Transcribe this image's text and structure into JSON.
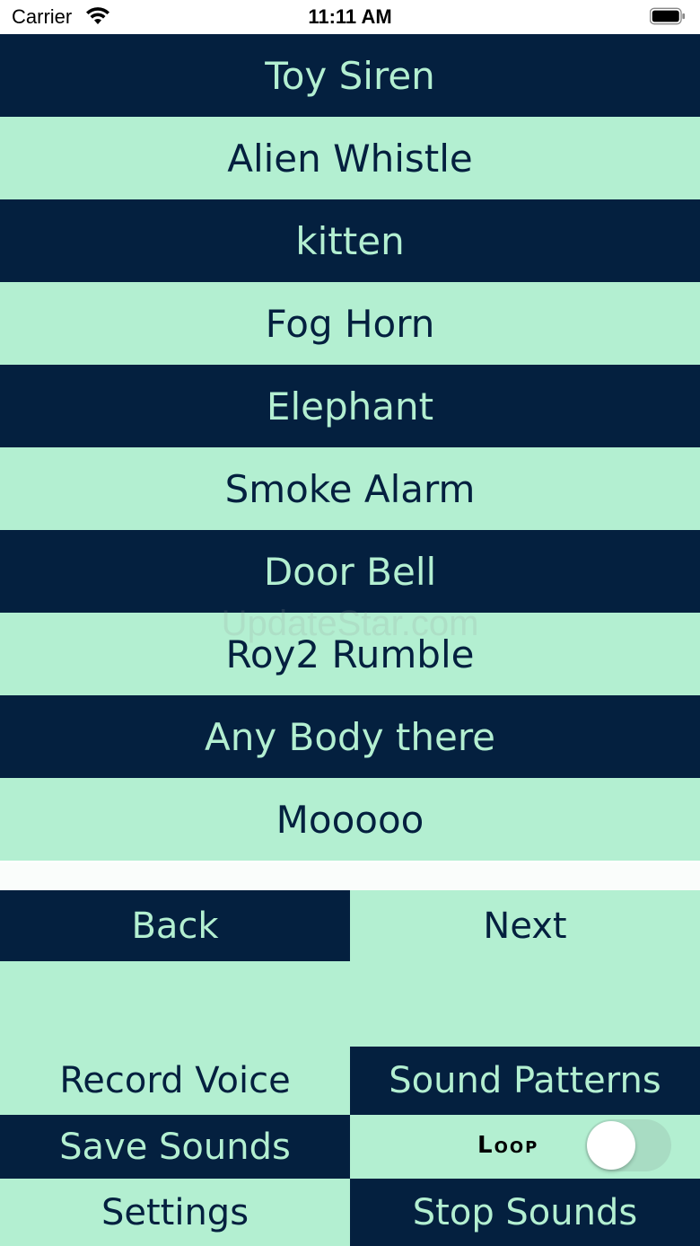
{
  "status_bar": {
    "carrier": "Carrier",
    "time": "11:11 AM"
  },
  "sounds": [
    {
      "label": "Toy Siren"
    },
    {
      "label": "Alien Whistle"
    },
    {
      "label": "kitten"
    },
    {
      "label": "Fog Horn"
    },
    {
      "label": "Elephant"
    },
    {
      "label": "Smoke Alarm"
    },
    {
      "label": "Door Bell"
    },
    {
      "label": "Roy2 Rumble"
    },
    {
      "label": "Any Body there"
    },
    {
      "label": "Mooooo"
    }
  ],
  "pager": {
    "back_label": "Back",
    "next_label": "Next"
  },
  "controls": {
    "record_voice": "Record Voice",
    "sound_patterns": "Sound Patterns",
    "save_sounds": "Save Sounds",
    "loop_label": "Loop",
    "loop_on": false,
    "settings": "Settings",
    "stop_sounds": "Stop Sounds"
  },
  "watermark": "UpdateStar.com",
  "colors": {
    "dark": "#04203f",
    "light": "#b3efd1"
  }
}
